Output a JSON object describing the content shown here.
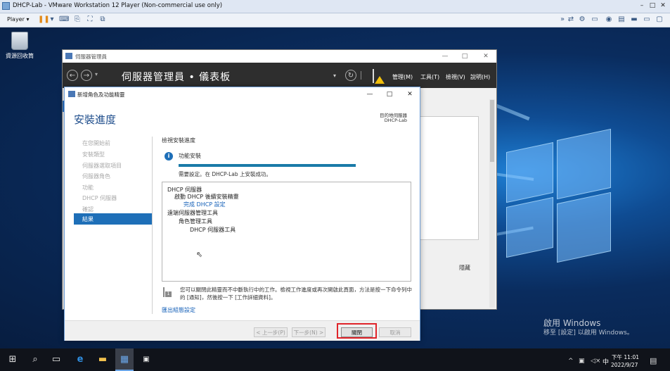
{
  "vmware": {
    "title": "DHCP-Lab - VMware Workstation 12 Player (Non-commercial use only)",
    "player_label": "Player",
    "player_chevron": "▾"
  },
  "desktop": {
    "recycle_bin_label": "資源回收筒",
    "activate_line1": "啟用 Windows",
    "activate_line2": "移至 [設定] 以啟用 Windows。"
  },
  "server_manager": {
    "title": "伺服器管理員",
    "breadcrumb": "伺服器管理員 • 儀表板",
    "menu": [
      "管理(M)",
      "工具(T)",
      "檢視(V)",
      "說明(H)"
    ],
    "hide_label": "隱藏"
  },
  "wizard": {
    "title": "新增角色及功能精靈",
    "heading": "安裝進度",
    "destination_label": "目的地伺服器",
    "destination_server": "DHCP-Lab",
    "steps": [
      "在您開始前",
      "安裝類型",
      "伺服器選取項目",
      "伺服器角色",
      "功能",
      "DHCP 伺服器",
      "確認",
      "結果"
    ],
    "active_step": "結果",
    "view_progress_label": "檢視安裝進度",
    "feature_install_label": "功能安裝",
    "progress_percent": 100,
    "success_message": "需要設定。在 DHCP-Lab 上安裝成功。",
    "results": [
      {
        "text": "DHCP 伺服器",
        "indent": 0,
        "link": false
      },
      {
        "text": "啟動 DHCP 後續安裝精靈",
        "indent": 1,
        "link": false
      },
      {
        "text": "完成 DHCP 設定",
        "indent": 2,
        "link": true
      },
      {
        "text": "遠端伺服器管理工具",
        "indent": 0,
        "link": false
      },
      {
        "text": "角色管理工具",
        "indent": 3,
        "link": false
      },
      {
        "text": "DHCP 伺服器工具",
        "indent": 4,
        "link": false
      }
    ],
    "notice": "您可以關閉此精靈而不中斷執行中的工作。檢視工作進度或再次開啟此頁面，方法是按一下命令列中的 [通知]，然後按一下 [工作詳細資料]。",
    "export_link": "匯出組態設定",
    "buttons": {
      "previous": "< 上一步(P)",
      "next": "下一步(N) >",
      "close": "關閉",
      "cancel": "取消"
    },
    "highlight_color": "#e0242a"
  },
  "taskbar": {
    "ime": "中",
    "time": "下午 11:01",
    "date": "2022/9/27",
    "icons": [
      "windows-start-icon",
      "search-icon",
      "task-view-icon",
      "edge-icon",
      "file-explorer-icon",
      "server-manager-icon",
      "cmd-icon"
    ]
  }
}
